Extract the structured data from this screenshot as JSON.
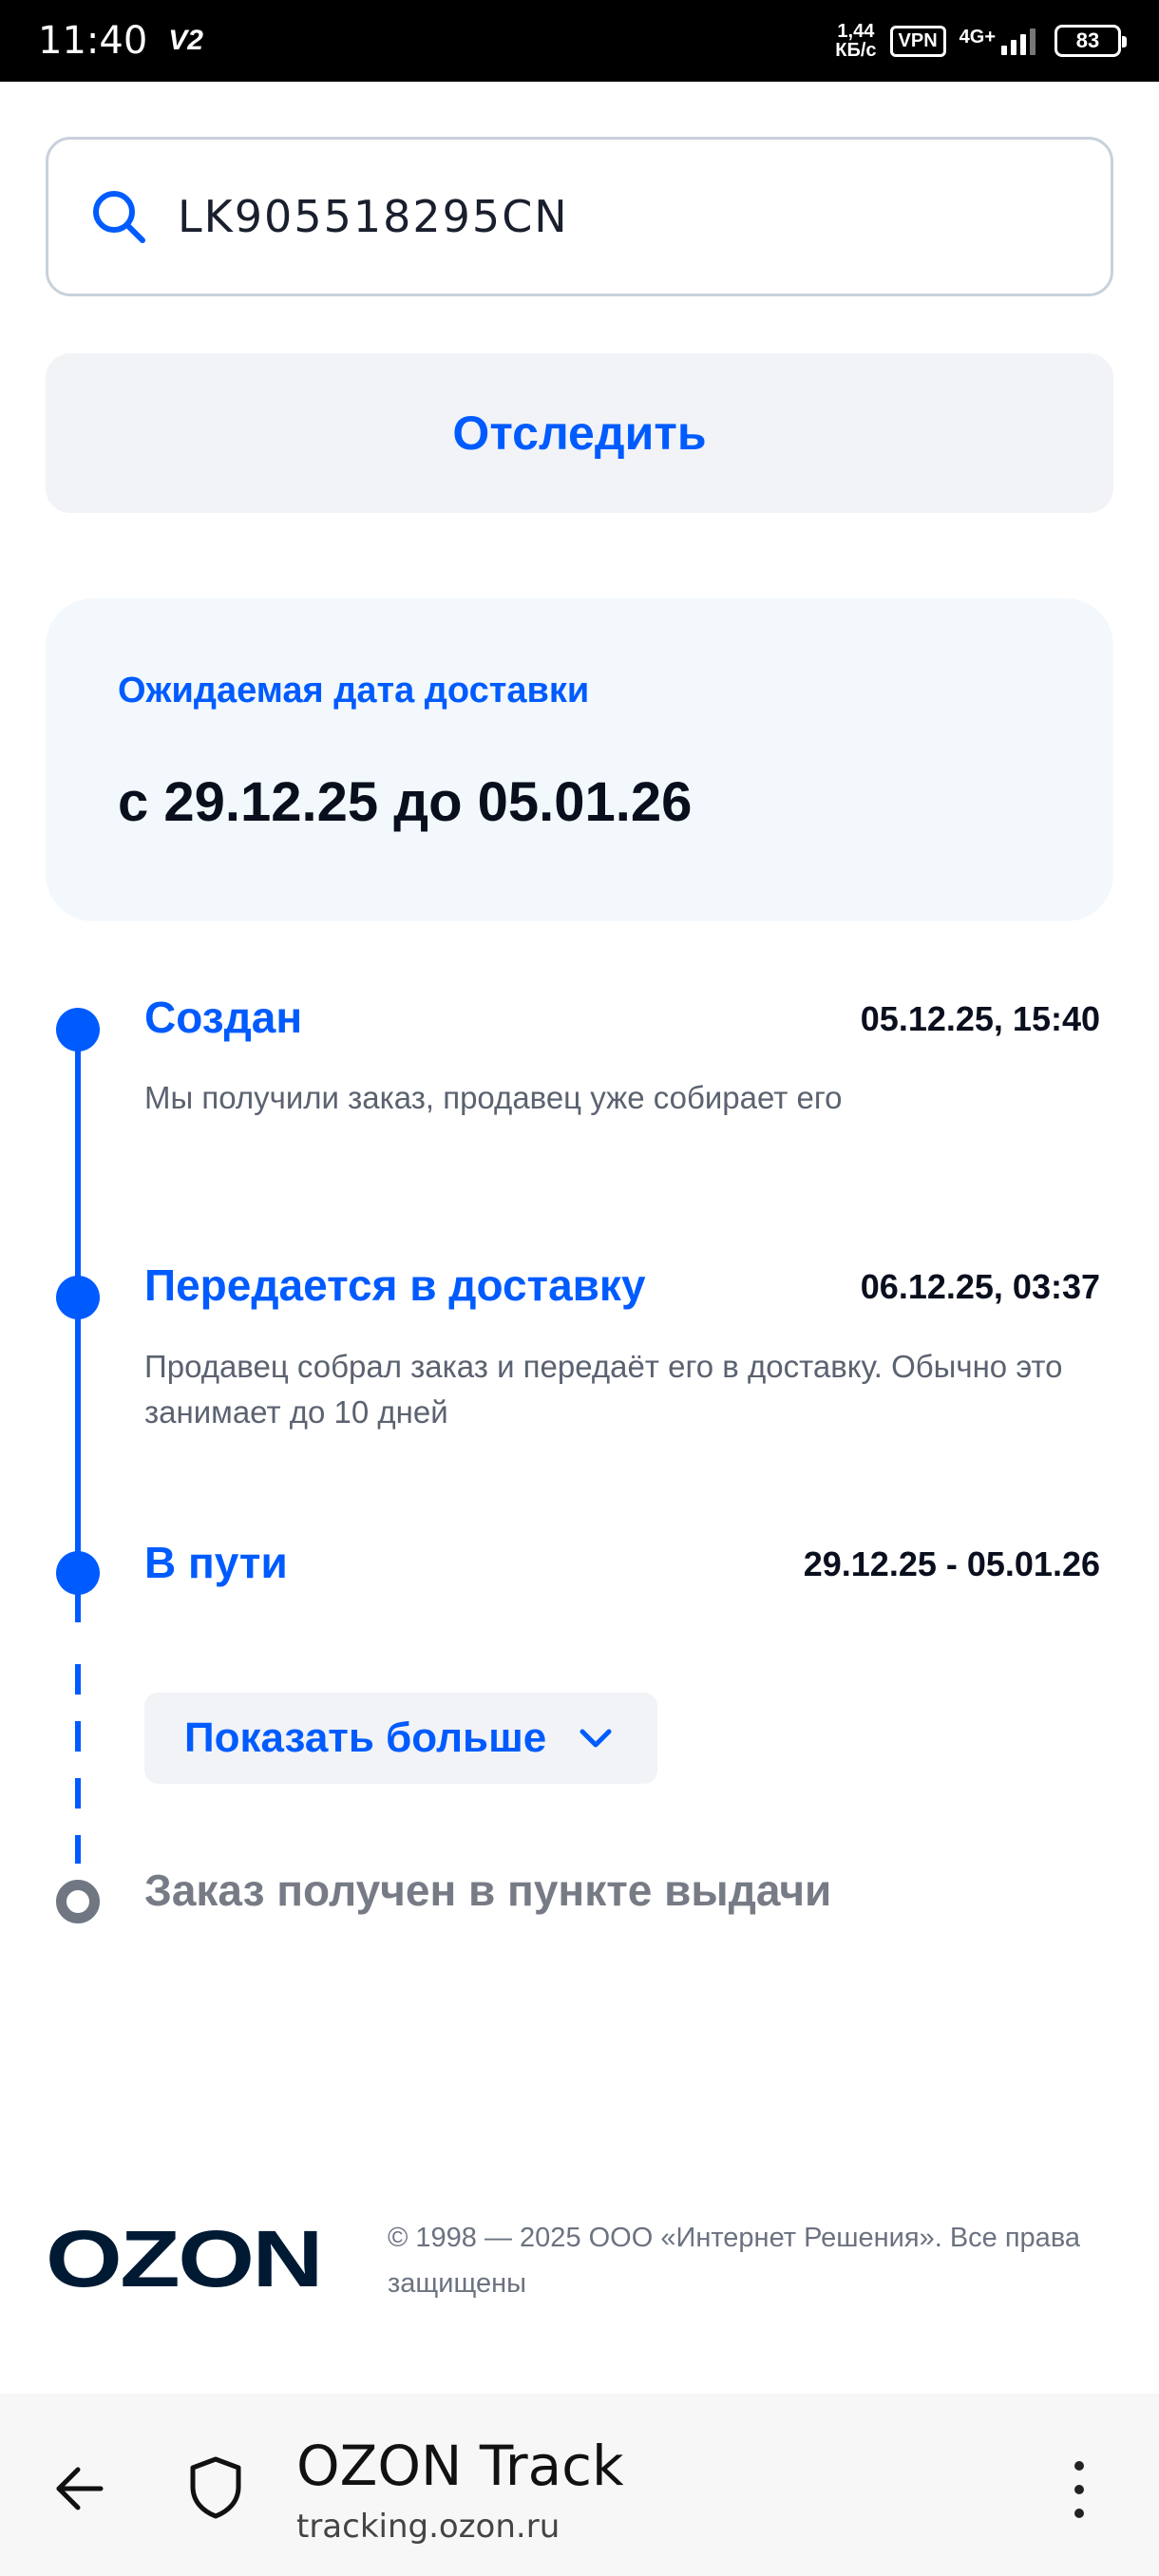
{
  "status_bar": {
    "time": "11:40",
    "carrier_badge": "V2",
    "net_speed_value": "1,44",
    "net_speed_unit": "КБ/с",
    "vpn": "VPN",
    "network_type": "4G+",
    "battery": "83"
  },
  "search": {
    "value": "LK905518295CN",
    "icon": "search-icon"
  },
  "track_button": {
    "label": "Отследить"
  },
  "delivery": {
    "label": "Ожидаемая дата доставки",
    "range": "с 29.12.25 до 05.01.26"
  },
  "timeline": {
    "steps": [
      {
        "title": "Создан",
        "date": "05.12.25, 15:40",
        "description": "Мы получили заказ, продавец уже собирает его"
      },
      {
        "title": "Передается в доставку",
        "date": "06.12.25, 03:37",
        "description": "Продавец собрал заказ и передаёт его в доставку. Обычно это занимает до 10 дней"
      },
      {
        "title": "В пути",
        "date": "29.12.25 - 05.01.26"
      }
    ],
    "show_more_label": "Показать больше",
    "final_step": {
      "title": "Заказ получен в пункте выдачи"
    }
  },
  "footer": {
    "logo_text": "OZON",
    "copyright": "© 1998 — 2025 ООО «Интернет Решения». Все права защищены"
  },
  "browser": {
    "title": "OZON Track",
    "url": "tracking.ozon.ru"
  },
  "colors": {
    "accent": "#005bff",
    "logo": "#001a34",
    "pending": "#707782"
  }
}
